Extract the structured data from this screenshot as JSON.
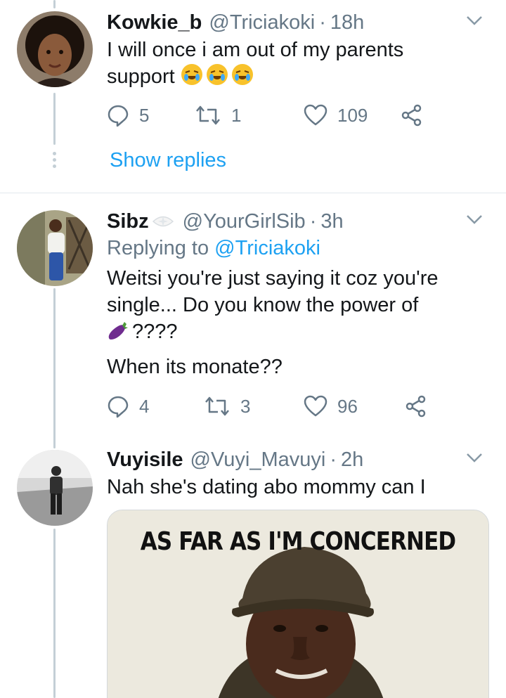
{
  "tweets": [
    {
      "name": "Kowkie_b",
      "handle": "@Triciakoki",
      "separator": "·",
      "time": "18h",
      "text": "I will once i am out of my parents support",
      "emoji": [
        "rolling-on-floor-laughing",
        "rolling-on-floor-laughing",
        "rolling-on-floor-laughing"
      ],
      "replies": "5",
      "retweets": "1",
      "likes": "109",
      "show_replies": "Show replies"
    },
    {
      "name": "Sibz",
      "handle": "@YourGirlSib",
      "separator": "·",
      "time": "3h",
      "replying_prefix": "Replying to",
      "replying_to": "@Triciakoki",
      "text_lines": [
        "Weitsi you're just saying it coz you're",
        "single... Do you know the power of"
      ],
      "emoji_text": "????",
      "text_last": "When its monate??",
      "replies": "4",
      "retweets": "3",
      "likes": "96"
    },
    {
      "name": "Vuyisile",
      "handle": "@Vuyi_Mavuyi",
      "separator": "·",
      "time": "2h",
      "text": "Nah she's dating abo mommy can I",
      "media_caption": "AS FAR AS I'M CONCERNED"
    }
  ],
  "colors": {
    "link": "#1da1f2",
    "secondary_text": "#657786",
    "thread_line": "#c4cfd6"
  },
  "icons": [
    "reply-icon",
    "retweet-icon",
    "like-icon",
    "share-icon",
    "caret-down-icon",
    "eggplant-emoji"
  ]
}
